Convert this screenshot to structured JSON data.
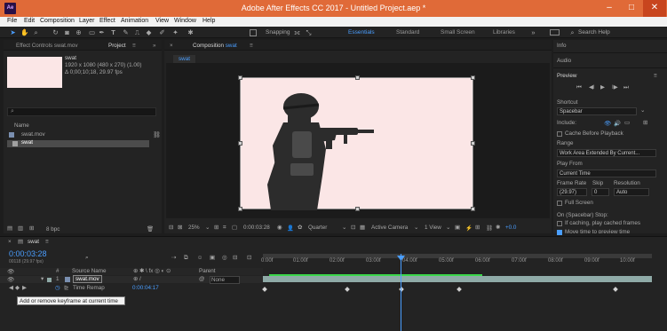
{
  "window": {
    "title": "Adobe After Effects CC 2017 - Untitled Project.aep *",
    "logo": "Ae"
  },
  "menu": [
    "File",
    "Edit",
    "Composition",
    "Layer",
    "Effect",
    "Animation",
    "View",
    "Window",
    "Help"
  ],
  "toolbar": {
    "snapping": "Snapping",
    "workspaces": [
      "Essentials",
      "Standard",
      "Small Screen",
      "Libraries"
    ],
    "search_placeholder": "Search Help"
  },
  "project": {
    "tab_effect": "Effect Controls swat.mov",
    "tab_project": "Project",
    "item": {
      "name": "swat",
      "dims": "1920 x 1080 (480 x 270) (1.00)",
      "duration": "Δ 0;00;10;18, 29.97 fps"
    },
    "column_name": "Name",
    "rows": [
      "swat.mov",
      "swat"
    ],
    "bpc": "8 bpc"
  },
  "composition": {
    "tab_prefix": "Composition",
    "tab_name": "swat",
    "sub_tab": "swat",
    "zoom": "25%",
    "timecode": "0:00:03:28",
    "resolution": "Quarter",
    "camera": "Active Camera",
    "view": "1 View",
    "exposure": "+0.0"
  },
  "right_panel": {
    "info": "Info",
    "audio": "Audio",
    "preview": "Preview",
    "shortcut_label": "Shortcut",
    "shortcut_value": "Spacebar",
    "include": "Include:",
    "cache": "Cache Before Playback",
    "range": "Range",
    "range_value": "Work Area Extended By Current...",
    "play_from": "Play From",
    "play_from_value": "Current Time",
    "frame_rate": "Frame Rate",
    "skip": "Skip",
    "resolution": "Resolution",
    "frame_rate_value": "(29.97)",
    "skip_value": "0",
    "resolution_value": "Auto",
    "full_screen": "Full Screen",
    "stop_label": "On (Spacebar) Stop:",
    "cached_frames": "If caching, play cached frames",
    "move_time": "Move time to preview time"
  },
  "timeline": {
    "comp_tab": "swat",
    "timecode": "0:00:03:28",
    "fps": "00118 (29.97 fps)",
    "col_source": "Source Name",
    "col_parent": "Parent",
    "layer_num": "1",
    "layer_name": "swat.mov",
    "parent_value": "None",
    "property": "Time Remap",
    "property_value": "0:00:04:17",
    "ruler": [
      "0:00f",
      "01:00f",
      "02:00f",
      "03:00f",
      "04:00f",
      "05:00f",
      "06:00f",
      "07:00f",
      "08:00f",
      "09:00f",
      "10:00f"
    ],
    "tooltip": "Add or remove keyframe at current time"
  }
}
